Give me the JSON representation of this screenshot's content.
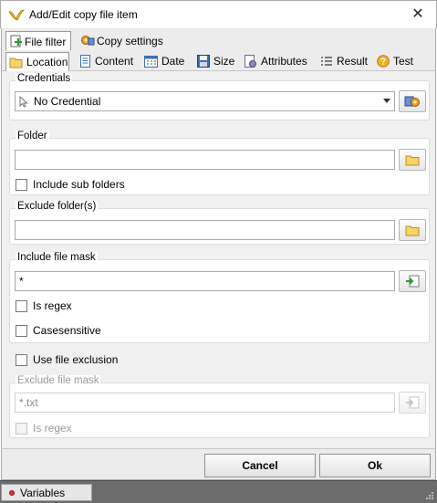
{
  "window": {
    "title": "Add/Edit copy file item"
  },
  "outer_tabs": [
    {
      "label": "File filter",
      "icon": "file-filter-icon",
      "active": true
    },
    {
      "label": "Copy settings",
      "icon": "copy-settings-icon",
      "active": false
    }
  ],
  "inner_tabs": [
    {
      "label": "Location",
      "icon": "folder-icon",
      "active": true
    },
    {
      "label": "Content",
      "icon": "document-icon"
    },
    {
      "label": "Date",
      "icon": "calendar-icon"
    },
    {
      "label": "Size",
      "icon": "floppy-disk-icon"
    },
    {
      "label": "Attributes",
      "icon": "attributes-icon"
    },
    {
      "label": "Result",
      "icon": "list-icon"
    },
    {
      "label": "Test",
      "icon": "help-icon"
    }
  ],
  "credentials": {
    "label": "Credentials",
    "selected": "No Credential"
  },
  "folder": {
    "label": "Folder",
    "value": "",
    "include_subfolders_label": "Include sub folders"
  },
  "exclude_folders": {
    "label": "Exclude folder(s)",
    "value": ""
  },
  "include_mask": {
    "label": "Include file mask",
    "value": "*",
    "is_regex_label": "Is regex",
    "casesensitive_label": "Casesensitive"
  },
  "use_file_exclusion_label": "Use file exclusion",
  "exclude_mask": {
    "label": "Exclude file mask",
    "value": "*.txt",
    "is_regex_label": "Is regex"
  },
  "buttons": {
    "cancel": "Cancel",
    "ok": "Ok"
  },
  "status": {
    "variables": "Variables"
  }
}
